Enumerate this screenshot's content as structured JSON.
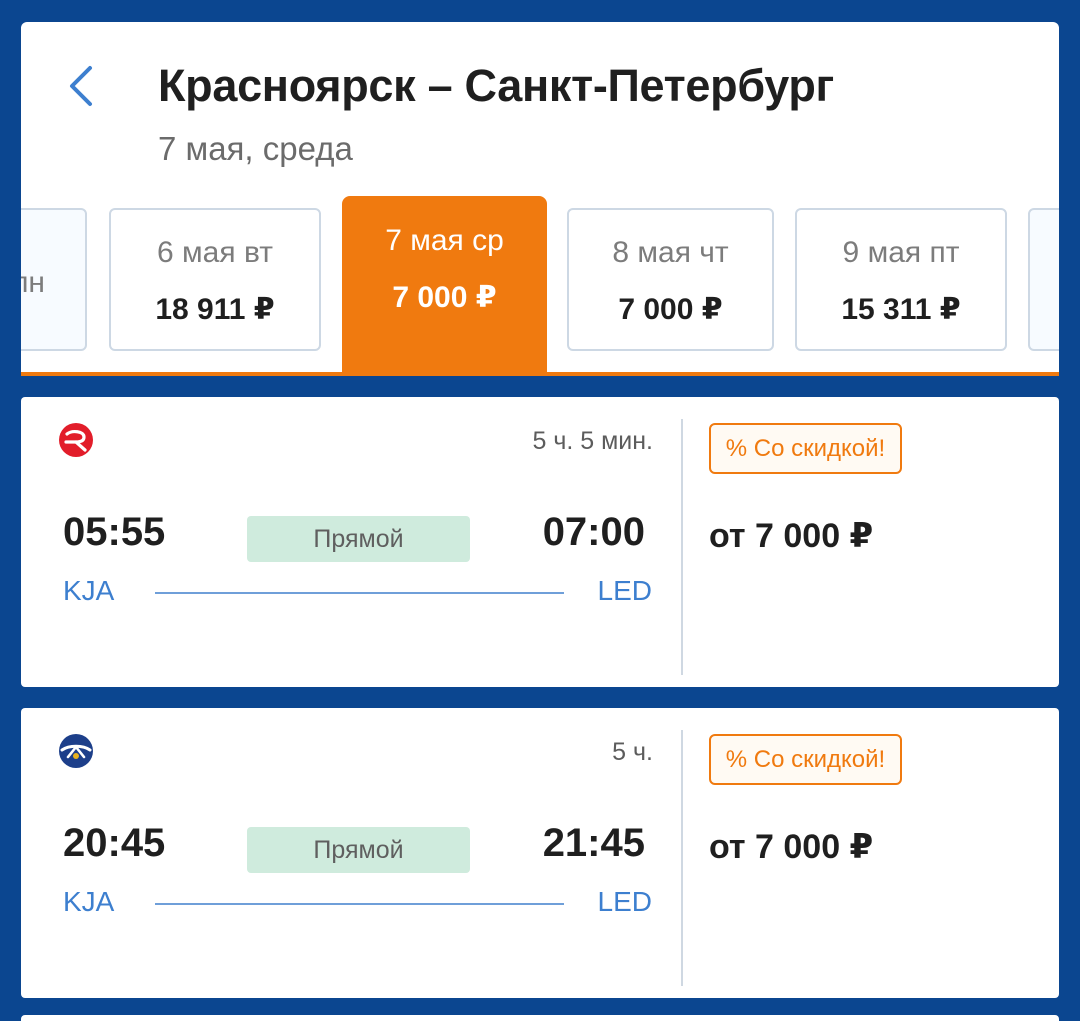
{
  "header": {
    "title": "Красноярск – Санкт-Петербург",
    "subtitle": "7 мая, среда"
  },
  "date_tabs": [
    {
      "label": "пн",
      "price": ""
    },
    {
      "label": "6 мая вт",
      "price": "18 911 ₽"
    },
    {
      "label": "7 мая ср",
      "price": "7 000 ₽",
      "active": true
    },
    {
      "label": "8 мая чт",
      "price": "7 000 ₽"
    },
    {
      "label": "9 мая пт",
      "price": "15 311 ₽"
    }
  ],
  "flights": [
    {
      "airline_icon": "red-wings-logo",
      "duration": "5 ч. 5 мин.",
      "departure_time": "05:55",
      "arrival_time": "07:00",
      "stops": "Прямой",
      "from": "KJA",
      "to": "LED",
      "badge": "% Со скидкой!",
      "price": "от 7 000 ₽"
    },
    {
      "airline_icon": "aeroflot-logo",
      "duration": "5 ч.",
      "departure_time": "20:45",
      "arrival_time": "21:45",
      "stops": "Прямой",
      "from": "KJA",
      "to": "LED",
      "badge": "% Со скидкой!",
      "price": "от 7 000 ₽"
    }
  ],
  "colors": {
    "background": "#0b4690",
    "accent": "#f07a0f",
    "link": "#3d7fcf",
    "direct_badge": "#cfebdd"
  }
}
